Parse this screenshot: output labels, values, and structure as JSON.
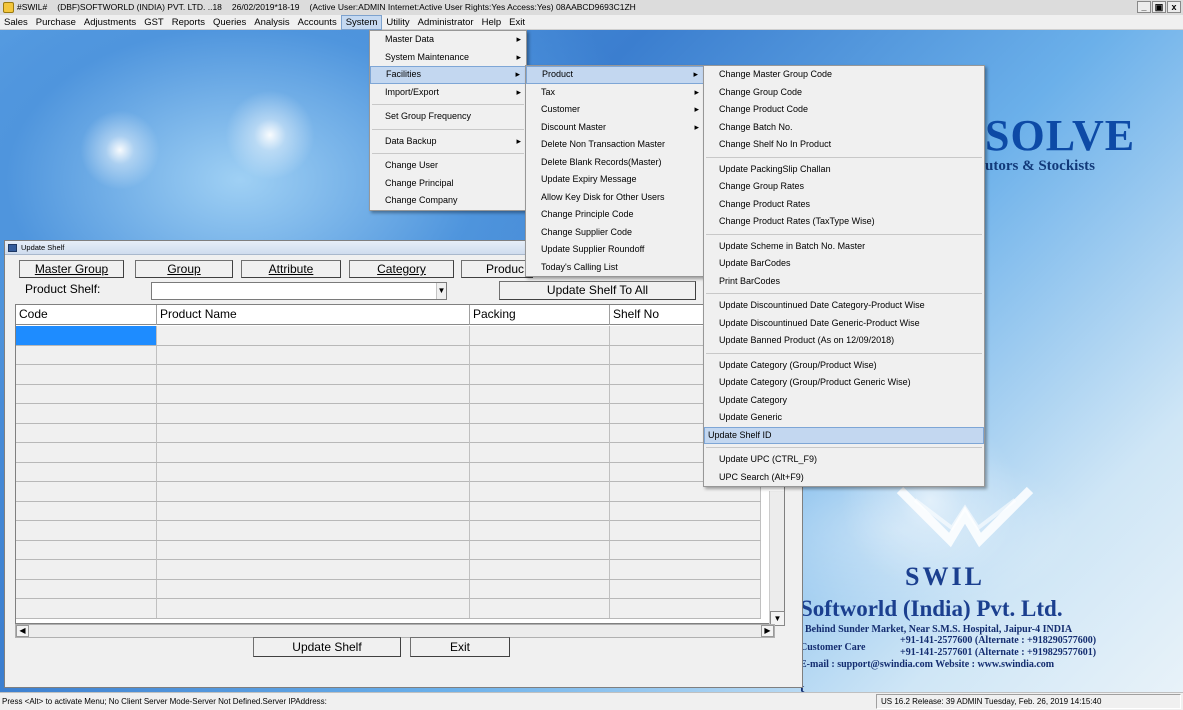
{
  "titlebar": {
    "app": "#SWIL#",
    "company": "(DBF)SOFTWORLD (INDIA) PVT. LTD. ..18",
    "datetime": "26/02/2019*18-19",
    "info": "(Active User:ADMIN Internet:Active  User Rights:Yes Access:Yes) 08AABCD9693C1ZH",
    "controls": [
      "_",
      "4",
      "x"
    ]
  },
  "menubar": {
    "items": [
      "Sales",
      "Purchase",
      "Adjustments",
      "GST",
      "Reports",
      "Queries",
      "Analysis",
      "Accounts",
      "System",
      "Utility",
      "Administrator",
      "Help",
      "Exit"
    ],
    "active": "System"
  },
  "system_menu": {
    "items": [
      "Master Data",
      "System Maintenance",
      "Facilities",
      "Import/Export",
      "Set Group Frequency",
      "Data Backup",
      "Change User",
      "Change Principal",
      "Change Company"
    ]
  },
  "facilities_menu": {
    "items": [
      "Product",
      "Tax",
      "Customer",
      "Discount Master",
      "Delete Non Transaction Master",
      "Delete Blank Records(Master)",
      "Update Expiry Message",
      "Allow Key Disk for Other Users",
      "Change Principle Code",
      "Change Supplier Code",
      "Update Supplier Roundoff",
      "Today's Calling List"
    ]
  },
  "product_menu": {
    "items": [
      "Change Master Group Code",
      "Change Group Code",
      "Change Product Code",
      "Change Batch No.",
      "Change Shelf No In Product",
      "Update PackingSlip Challan",
      "Change Group Rates",
      "Change Product Rates",
      "Change Product Rates (TaxType Wise)",
      "Update Scheme in Batch No. Master",
      "Update BarCodes",
      "Print BarCodes",
      "Update Discountinued Date Category-Product Wise",
      "Update Discountinued Date Generic-Product Wise",
      "Update Banned Product (As on 12/09/2018)",
      "Update Category (Group/Product Wise)",
      "Update Category (Group/Product Generic Wise)",
      "Update Category",
      "Update Generic",
      "Update Shelf ID",
      "Update UPC  (CTRL_F9)",
      "UPC Search (Alt+F9)"
    ],
    "highlighted": "Update Shelf ID"
  },
  "window": {
    "title": "Update Shelf",
    "tabs": [
      "Master Group",
      "Group",
      "Attribute",
      "Category",
      "Produc"
    ],
    "shelf_label": "Product Shelf:",
    "shelf_value": "",
    "update_all_label": "Update Shelf To All",
    "columns": [
      "Code",
      "Product Name",
      "Packing",
      "Shelf No"
    ],
    "update_button": "Update Shelf",
    "exit_button": "Exit"
  },
  "background": {
    "brand": "SOLVE",
    "tagline": "utors & Stockists",
    "swil": "SWIL",
    "company": "Softworld (India) Pvt. Ltd.",
    "address": ", Behind Sunder Market, Near S.M.S. Hospital, Jaipur-4 INDIA",
    "care_label": "Customer Care",
    "phone1": "+91-141-2577600 (Alternate : +918290577600)",
    "phone2": "+91-141-2577601 (Alternate : +919829577601)",
    "email": "E-mail : support@swindia.com   Website : www.swindia.com",
    "t": "t"
  },
  "status": {
    "left": "Press <Alt> to activate Menu; No Client Server Mode-Server Not Defined.Server IPAddress:",
    "right": "US 16.2 Release: 39 ADMIN Tuesday, Feb. 26, 2019  14:15:40"
  },
  "colors": {
    "accent": "#1e8cff",
    "menu_highlight": "#c3d7f0",
    "brand_blue": "#1b3f8f"
  }
}
